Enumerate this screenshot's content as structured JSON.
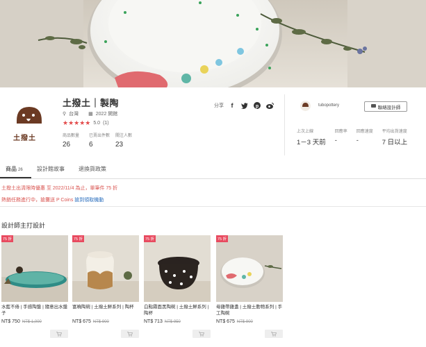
{
  "shop": {
    "name": "土撥土｜製陶",
    "logo_text": "土撥土",
    "location": "台灣",
    "joined": "2022 開館",
    "rating_stars": "★★★★★",
    "rating_value": "5.0",
    "rating_count": "(1)",
    "stats": [
      {
        "label": "商品數量",
        "value": "26"
      },
      {
        "label": "已賣出件數",
        "value": "6"
      },
      {
        "label": "關注人數",
        "value": "23"
      }
    ]
  },
  "share": {
    "label": "分享",
    "icons": [
      "facebook-icon",
      "twitter-icon",
      "pinterest-icon",
      "weibo-icon"
    ]
  },
  "owner": {
    "username": "tubopottery",
    "contact_label": "聯絡設計師",
    "response": [
      {
        "label": "上次上線",
        "value": "1－3 天前"
      },
      {
        "label": "回應率",
        "value": "-"
      },
      {
        "label": "回應速度",
        "value": "-"
      },
      {
        "label": "平均出貨速度",
        "value": "7 日以上"
      }
    ]
  },
  "tabs": [
    {
      "label": "商品",
      "count": "26",
      "active": true
    },
    {
      "label": "設計館故事",
      "count": "",
      "active": false
    },
    {
      "label": "退換貨政策",
      "count": "",
      "active": false
    }
  ],
  "notices": {
    "line1": "土撥土出清限時優惠 至 2022/11/4 為止，單筆件 75 折",
    "line2_prefix": "熱銷任務進行中，搶攤送 P Coins ",
    "line2_link": "搶到領取機動"
  },
  "section_title": "設計師主打設計",
  "products": [
    {
      "badge": "75 折",
      "title": "水藍不倦 | 手感陶盤 | 隨意出水盤子",
      "price": "NT$ 750",
      "orig": "NT$ 1,000"
    },
    {
      "badge": "75 折",
      "title": "富曉陶碗 | 土撥土鮮系列 | 陶杯",
      "price": "NT$ 675",
      "orig": "NT$ 900"
    },
    {
      "badge": "75 折",
      "title": "白點霧面黑陶碗 | 土撥土鮮系列 | 陶杯",
      "price": "NT$ 713",
      "orig": "NT$ 950"
    },
    {
      "badge": "75 折",
      "title": "母雞帶雞盞 | 土撥土動物系列 | 手工陶碗",
      "price": "NT$ 675",
      "orig": "NT$ 900"
    }
  ],
  "colors": {
    "accent_red": "#e34b4b",
    "badge_red": "#e84a5f",
    "link_blue": "#2a6ebd"
  }
}
